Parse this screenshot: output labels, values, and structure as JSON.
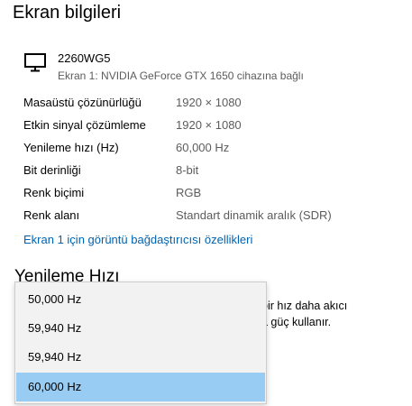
{
  "section": {
    "title": "Ekran bilgileri"
  },
  "monitor": {
    "icon": "monitor-icon",
    "name": "2260WG5",
    "subtitle": "Ekran 1: NVIDIA GeForce GTX 1650 cihazına bağlı"
  },
  "properties": [
    {
      "label": "Masaüstü çözünürlüğü",
      "value": "1920 × 1080"
    },
    {
      "label": "Etkin sinyal çözümleme",
      "value": "1920 × 1080"
    },
    {
      "label": "Yenileme hızı (Hz)",
      "value": "60,000 Hz"
    },
    {
      "label": "Bit derinliği",
      "value": "8-bit"
    },
    {
      "label": "Renk biçimi",
      "value": "RGB"
    },
    {
      "label": "Renk alanı",
      "value": "Standart dinamik aralık (SDR)"
    }
  ],
  "adapter_link": "Ekran 1 için görüntü bağdaştırıcısı özellikleri",
  "refresh": {
    "title": "Yenileme Hızı",
    "description_lines": [
      "bir hız daha akıcı",
      "a güç kullanır."
    ],
    "options": [
      "50,000 Hz",
      "59,940 Hz",
      "59,940 Hz",
      "60,000 Hz"
    ],
    "selected_index": 3
  },
  "colors": {
    "link": "#0063b1",
    "secondary_text": "#5c5c5c",
    "selected_option": "#99ccf3",
    "dropdown_background": "#f2f2f2"
  }
}
